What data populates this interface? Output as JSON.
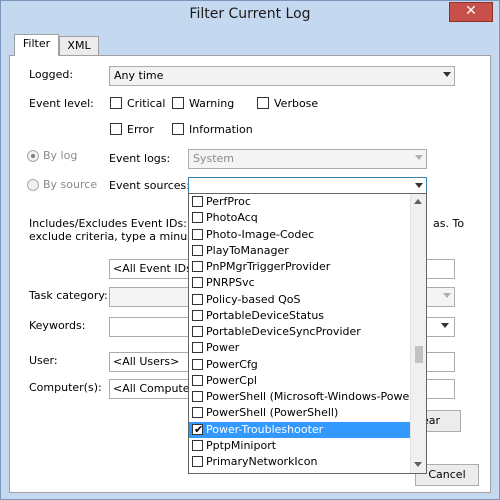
{
  "window": {
    "title": "Filter Current Log",
    "close_glyph": "✕"
  },
  "tabs": [
    {
      "label": "Filter"
    },
    {
      "label": "XML"
    }
  ],
  "logged": {
    "label": "Logged:",
    "value": "Any time"
  },
  "event_level": {
    "label": "Event level:",
    "options": [
      {
        "label": "Critical"
      },
      {
        "label": "Warning"
      },
      {
        "label": "Verbose"
      },
      {
        "label": "Error"
      },
      {
        "label": "Information"
      }
    ]
  },
  "by_log": {
    "label": "By log",
    "field_label": "Event logs:",
    "value": "System"
  },
  "by_source": {
    "label": "By source",
    "field_label": "Event sources:",
    "value": ""
  },
  "event_ids": {
    "description_line1": "Includes/Excludes Event IDs: Ente",
    "description_tail1": "as. To",
    "description_line2": "exclude criteria, type a minus sign",
    "value": "<All Event IDs>"
  },
  "task_category": {
    "label": "Task category:"
  },
  "keywords": {
    "label": "Keywords:"
  },
  "user": {
    "label": "User:",
    "value": "<All Users>"
  },
  "computers": {
    "label": "Computer(s):",
    "value": "<All Computers"
  },
  "buttons": {
    "clear": "ear",
    "cancel": "Cancel"
  },
  "event_sources_list": [
    {
      "label": "PerfProc",
      "checked": false
    },
    {
      "label": "PhotoAcq",
      "checked": false
    },
    {
      "label": "Photo-Image-Codec",
      "checked": false
    },
    {
      "label": "PlayToManager",
      "checked": false
    },
    {
      "label": "PnPMgrTriggerProvider",
      "checked": false
    },
    {
      "label": "PNRPSvc",
      "checked": false
    },
    {
      "label": "Policy-based QoS",
      "checked": false
    },
    {
      "label": "PortableDeviceStatus",
      "checked": false
    },
    {
      "label": "PortableDeviceSyncProvider",
      "checked": false
    },
    {
      "label": "Power",
      "checked": false
    },
    {
      "label": "PowerCfg",
      "checked": false
    },
    {
      "label": "PowerCpl",
      "checked": false
    },
    {
      "label": "PowerShell (Microsoft-Windows-PowerShell)",
      "checked": false
    },
    {
      "label": "PowerShell (PowerShell)",
      "checked": false
    },
    {
      "label": "Power-Troubleshooter",
      "checked": true,
      "selected": true
    },
    {
      "label": "PptpMiniport",
      "checked": false
    },
    {
      "label": "PrimaryNetworkIcon",
      "checked": false
    }
  ]
}
